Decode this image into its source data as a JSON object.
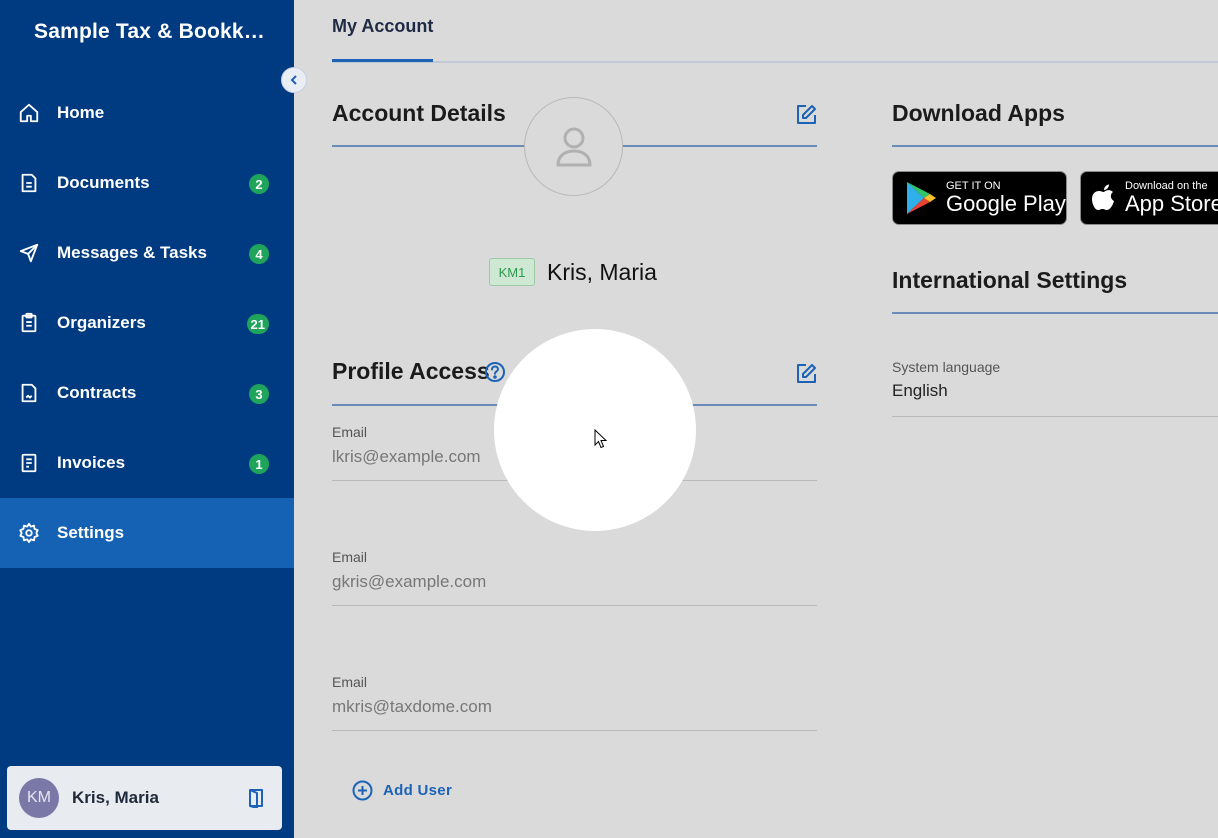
{
  "sidebar": {
    "brand": "Sample Tax & Bookkeeping",
    "items": [
      {
        "label": "Home",
        "icon": "home-icon",
        "badge": ""
      },
      {
        "label": "Documents",
        "icon": "document-icon",
        "badge": "2"
      },
      {
        "label": "Messages & Tasks",
        "icon": "paper-plane-icon",
        "badge": "4"
      },
      {
        "label": "Organizers",
        "icon": "clipboard-icon",
        "badge": "21"
      },
      {
        "label": "Contracts",
        "icon": "contract-icon",
        "badge": "3"
      },
      {
        "label": "Invoices",
        "icon": "invoice-icon",
        "badge": "1"
      },
      {
        "label": "Settings",
        "icon": "gear-icon",
        "badge": ""
      }
    ],
    "active_item": "Settings",
    "user": {
      "initials": "KM",
      "name": "Kris, Maria"
    }
  },
  "tabs": [
    {
      "label": "My Account",
      "active": true
    }
  ],
  "account_details": {
    "title": "Account Details",
    "badge": "KM1",
    "name": "Kris, Maria"
  },
  "profile_access": {
    "title": "Profile Access",
    "emails": [
      {
        "label": "Email",
        "value": "lkris@example.com"
      },
      {
        "label": "Email",
        "value": "gkris@example.com"
      },
      {
        "label": "Email",
        "value": "mkris@taxdome.com"
      }
    ],
    "add_user_label": "Add User"
  },
  "download_apps": {
    "title": "Download Apps",
    "google_play": {
      "small": "GET IT ON",
      "big": "Google Play"
    },
    "app_store": {
      "small": "Download on the",
      "big": "App Store"
    }
  },
  "international_settings": {
    "title": "International Settings",
    "language_label": "System language",
    "language_value": "English"
  },
  "colors": {
    "sidebar_bg": "#003a80",
    "active_item_bg": "#1561b4",
    "badge_green": "#1fa45c",
    "accent_blue": "#1c63b7"
  }
}
